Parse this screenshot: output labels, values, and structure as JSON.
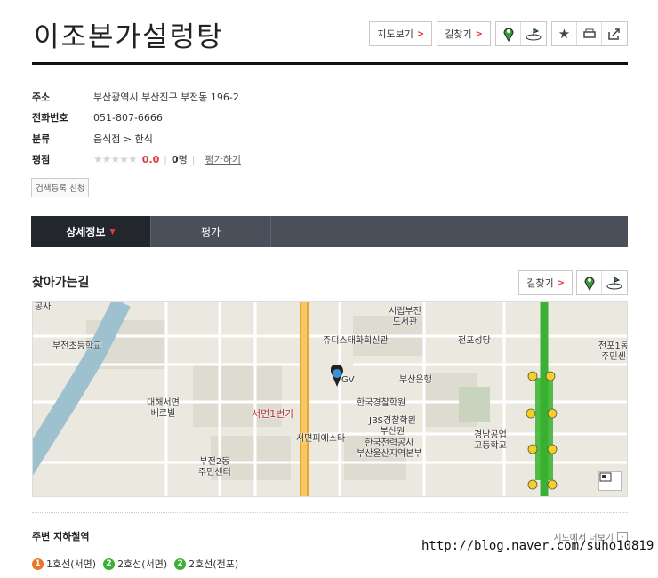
{
  "place": {
    "title": "이조본가설렁탕"
  },
  "header_buttons": {
    "map_view": "지도보기",
    "directions": "길찾기",
    "arrow": "›"
  },
  "info": {
    "address_label": "주소",
    "address": "부산광역시 부산진구 부전동 196-2",
    "phone_label": "전화번호",
    "phone": "051-807-6666",
    "category_label": "분류",
    "category": "음식점 > 한식",
    "rating_label": "평점",
    "stars": "★★★★★",
    "score": "0.0",
    "count_num": "0",
    "count_unit": "명",
    "rate_link": "평가하기"
  },
  "register_button": "검색등록 신청",
  "tabs": [
    {
      "label": "상세정보",
      "active": true
    },
    {
      "label": "평가",
      "active": false
    }
  ],
  "directions_section": {
    "title": "찾아가는길",
    "directions_button": "길찾기"
  },
  "map_labels": {
    "l1": "공사",
    "l2": "부전초등학교",
    "l3": "시립부전\n도서관",
    "l4": "쥬디스태화회신관",
    "l5": "전포성당",
    "l6": "부산은행",
    "l7": "GV",
    "l8": "대해서면\n베르빌",
    "l9": "서면1번가",
    "l10": "한국경찰학원",
    "l11": "JBS경찰학원\n부산원",
    "l12": "한국전력공사\n부산울산지역본부",
    "l13": "서면피에스타",
    "l14": "경남공업\n고등학교",
    "l15": "부전2동\n주민센터",
    "l16": "전포1동\n주민센",
    "l17": "서면"
  },
  "subway": {
    "title": "주변 지하철역",
    "more": "지도에서 더보기",
    "stations": [
      {
        "num": "1",
        "name": "1호선(서면)",
        "color": "#e8772e"
      },
      {
        "num": "2",
        "name": "2호선(서면)",
        "color": "#3cb034"
      },
      {
        "num": "2",
        "name": "2호선(전포)",
        "color": "#3cb034"
      }
    ]
  },
  "watermark": "http://blog.naver.com/suho10819",
  "colors": {
    "accent": "#e03a3a",
    "tab_bg": "#4a4f5a",
    "tab_active": "#23262d",
    "line2": "#3cb034",
    "line1": "#e8772e"
  }
}
